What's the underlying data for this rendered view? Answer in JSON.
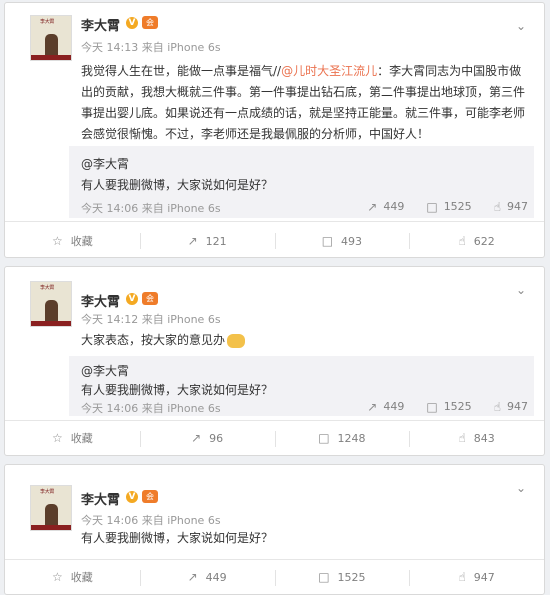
{
  "posts": [
    {
      "name": "李大霄",
      "meta": "今天 14:13 来自 iPhone 6s",
      "text_before": "我觉得人生在世，能做一点事是福气//",
      "text_link": "@儿时大圣江流儿",
      "text_after": "：李大霄同志为中国股市做出的贡献，我想大概就三件事。第一件事提出钻石底，第二件事提出地球顶，第三件事提出婴儿底。如果说还有一点成绩的话，就是坚持正能量。就三件事，可能李老师会感觉很惭愧。不过，李老师还是我最佩服的分析师，中国好人！",
      "repost": {
        "name": "@李大霄",
        "text": "有人要我删微博，大家说如何是好？",
        "meta": "今天 14:06 来自 iPhone 6s",
        "reposts": "449",
        "comments": "1525",
        "likes": "947"
      },
      "actions": {
        "collect": "收藏",
        "reposts": "121",
        "comments": "493",
        "likes": "622"
      }
    },
    {
      "name": "李大霄",
      "meta": "今天 14:12 来自 iPhone 6s",
      "text": "大家表态，按大家的意见办",
      "repost": {
        "name": "@李大霄",
        "text": "有人要我删微博，大家说如何是好？",
        "meta": "今天 14:06 来自 iPhone 6s",
        "reposts": "449",
        "comments": "1525",
        "likes": "947"
      },
      "actions": {
        "collect": "收藏",
        "reposts": "96",
        "comments": "1248",
        "likes": "843"
      }
    },
    {
      "name": "李大霄",
      "meta": "今天 14:06 来自 iPhone 6s",
      "text": "有人要我删微博，大家说如何是好？",
      "actions": {
        "collect": "收藏",
        "reposts": "449",
        "comments": "1525",
        "likes": "947"
      }
    }
  ],
  "avatar_book_title": "李大霄",
  "badges": {
    "verified": "V",
    "member": "会"
  },
  "icons": {
    "collect": "star-icon",
    "repost": "repost-icon",
    "comment": "comment-icon",
    "like": "thumbs-up-icon",
    "menu": "chevron-down-icon"
  },
  "colors": {
    "link": "#eb7350",
    "verified": "#f4a922",
    "member": "#ef7c2a"
  }
}
